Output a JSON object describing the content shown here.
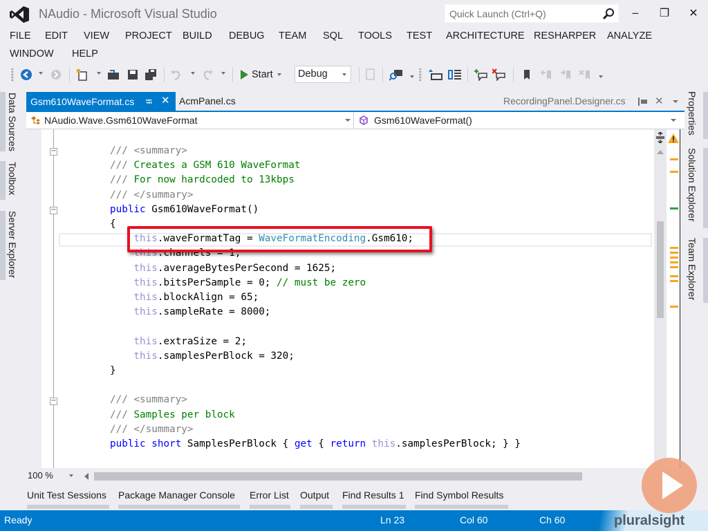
{
  "window": {
    "title": "NAudio - Microsoft Visual Studio",
    "quick_launch_placeholder": "Quick Launch (Ctrl+Q)",
    "minimize_glyph": "‒",
    "restore_glyph": "❐",
    "close_glyph": "✕"
  },
  "menu": [
    "FILE",
    "EDIT",
    "VIEW",
    "PROJECT",
    "BUILD",
    "DEBUG",
    "TEAM",
    "SQL",
    "TOOLS",
    "TEST",
    "ARCHITECTURE",
    "RESHARPER",
    "ANALYZE",
    "WINDOW",
    "HELP"
  ],
  "toolbar": {
    "start_label": "Start",
    "configuration": "Debug",
    "icons": [
      "navigate-back-icon",
      "navigate-forward-icon",
      "new-project-icon",
      "open-file-icon",
      "save-icon",
      "save-all-icon",
      "undo-icon",
      "redo-icon",
      "start-icon",
      "find-in-files-icon",
      "step-into-icon",
      "outline-icon",
      "add-comment-icon",
      "remove-comment-icon",
      "bookmark-icon",
      "prev-bookmark-icon",
      "next-bookmark-icon",
      "clear-bookmarks-icon"
    ]
  },
  "side_tabs_left": [
    "Data Sources",
    "Toolbox",
    "Server Explorer"
  ],
  "side_tabs_right": [
    "Properties",
    "Solution Explorer",
    "Team Explorer"
  ],
  "document_tabs": {
    "active": "Gsm610WaveFormat.cs",
    "pin_glyph": "⭾",
    "close_glyph": "✕",
    "inactive": "AcmPanel.cs",
    "preview": "RecordingPanel.Designer.cs"
  },
  "navigation_bar": {
    "type": "NAudio.Wave.Gsm610WaveFormat",
    "member": "Gsm610WaveFormat()"
  },
  "code_lines": [
    [
      {
        "t": "/// ",
        "c": "c-gray"
      },
      {
        "t": "<summary>",
        "c": "c-gray"
      }
    ],
    [
      {
        "t": "/// ",
        "c": "c-gray"
      },
      {
        "t": "Creates a GSM 610 WaveFormat",
        "c": "c-green"
      }
    ],
    [
      {
        "t": "/// ",
        "c": "c-gray"
      },
      {
        "t": "For now hardcoded to 13kbps",
        "c": "c-green"
      }
    ],
    [
      {
        "t": "/// ",
        "c": "c-gray"
      },
      {
        "t": "</summary>",
        "c": "c-gray"
      }
    ],
    [
      {
        "t": "public",
        "c": "c-blue"
      },
      {
        "t": " Gsm610WaveFormat()",
        "c": "c-plain"
      }
    ],
    [
      {
        "t": "{",
        "c": "c-plain"
      }
    ],
    [
      {
        "t": "    this",
        "c": "c-this"
      },
      {
        "t": ".waveFormatTag = ",
        "c": "c-plain"
      },
      {
        "t": "WaveFormatEncoding",
        "c": "c-type"
      },
      {
        "t": ".Gsm610;",
        "c": "c-plain"
      }
    ],
    [
      {
        "t": "    this",
        "c": "c-this"
      },
      {
        "t": ".channels = 1;",
        "c": "c-plain"
      }
    ],
    [
      {
        "t": "    this",
        "c": "c-this"
      },
      {
        "t": ".averageBytesPerSecond = 1625;",
        "c": "c-plain"
      }
    ],
    [
      {
        "t": "    this",
        "c": "c-this"
      },
      {
        "t": ".bitsPerSample = 0; ",
        "c": "c-plain"
      },
      {
        "t": "// must be zero",
        "c": "c-green"
      }
    ],
    [
      {
        "t": "    this",
        "c": "c-this"
      },
      {
        "t": ".blockAlign = 65;",
        "c": "c-plain"
      }
    ],
    [
      {
        "t": "    this",
        "c": "c-this"
      },
      {
        "t": ".sampleRate = 8000;",
        "c": "c-plain"
      }
    ],
    [],
    [
      {
        "t": "    this",
        "c": "c-this"
      },
      {
        "t": ".extraSize = 2;",
        "c": "c-plain"
      }
    ],
    [
      {
        "t": "    this",
        "c": "c-this"
      },
      {
        "t": ".samplesPerBlock = 320;",
        "c": "c-plain"
      }
    ],
    [
      {
        "t": "}",
        "c": "c-plain"
      }
    ],
    [],
    [
      {
        "t": "/// ",
        "c": "c-gray"
      },
      {
        "t": "<summary>",
        "c": "c-gray"
      }
    ],
    [
      {
        "t": "/// ",
        "c": "c-gray"
      },
      {
        "t": "Samples per block",
        "c": "c-green"
      }
    ],
    [
      {
        "t": "/// ",
        "c": "c-gray"
      },
      {
        "t": "</summary>",
        "c": "c-gray"
      }
    ],
    [
      {
        "t": "public",
        "c": "c-blue"
      },
      {
        "t": " ",
        "c": "c-plain"
      },
      {
        "t": "short",
        "c": "c-blue"
      },
      {
        "t": " SamplesPerBlock { ",
        "c": "c-plain"
      },
      {
        "t": "get",
        "c": "c-blue"
      },
      {
        "t": " { ",
        "c": "c-plain"
      },
      {
        "t": "return",
        "c": "c-blue"
      },
      {
        "t": " ",
        "c": "c-plain"
      },
      {
        "t": "this",
        "c": "c-this"
      },
      {
        "t": ".samplesPerBlock; } }",
        "c": "c-plain"
      }
    ]
  ],
  "editor": {
    "zoom_level": "100 %"
  },
  "bottom_tabs": [
    "Unit Test Sessions",
    "Package Manager Console",
    "Error List",
    "Output",
    "Find Results 1",
    "Find Symbol Results"
  ],
  "status_bar": {
    "state": "Ready",
    "line": "Ln 23",
    "column": "Col 60",
    "char": "Ch 60"
  },
  "overlay": {
    "brand": "pluralsight"
  },
  "colors": {
    "accent": "#007acc",
    "highlight_border": "#e81123",
    "warning_marker": "#f5a623",
    "change_marker": "#2ea043"
  }
}
